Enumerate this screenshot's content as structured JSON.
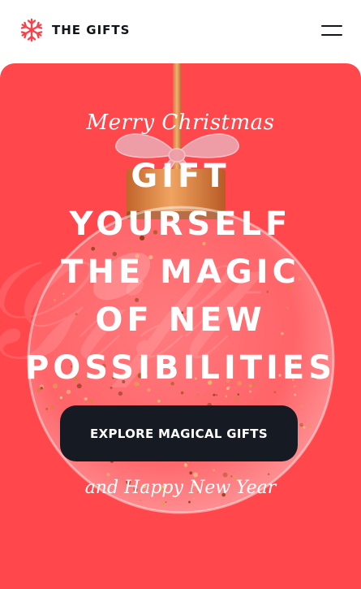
{
  "header": {
    "brand_name": "THE GIFTS",
    "logo_icon": "snowflake-icon",
    "menu_icon": "hamburger-menu-icon"
  },
  "hero": {
    "greeting": "Merry Christmas",
    "headline_lines": [
      "GIFT",
      "YOURSELF",
      "THE MAGIC",
      "OF NEW",
      "POSSIBILITIES"
    ],
    "cta_label": "EXPLORE MAGICAL GIFTS",
    "closing": "and Happy New Year"
  },
  "colors": {
    "accent": "#ff474c",
    "logo": "#f4444c",
    "button": "#161a23",
    "text_dark": "#111418",
    "ribbon": "#e89aa5",
    "cap": "#d9803f"
  }
}
